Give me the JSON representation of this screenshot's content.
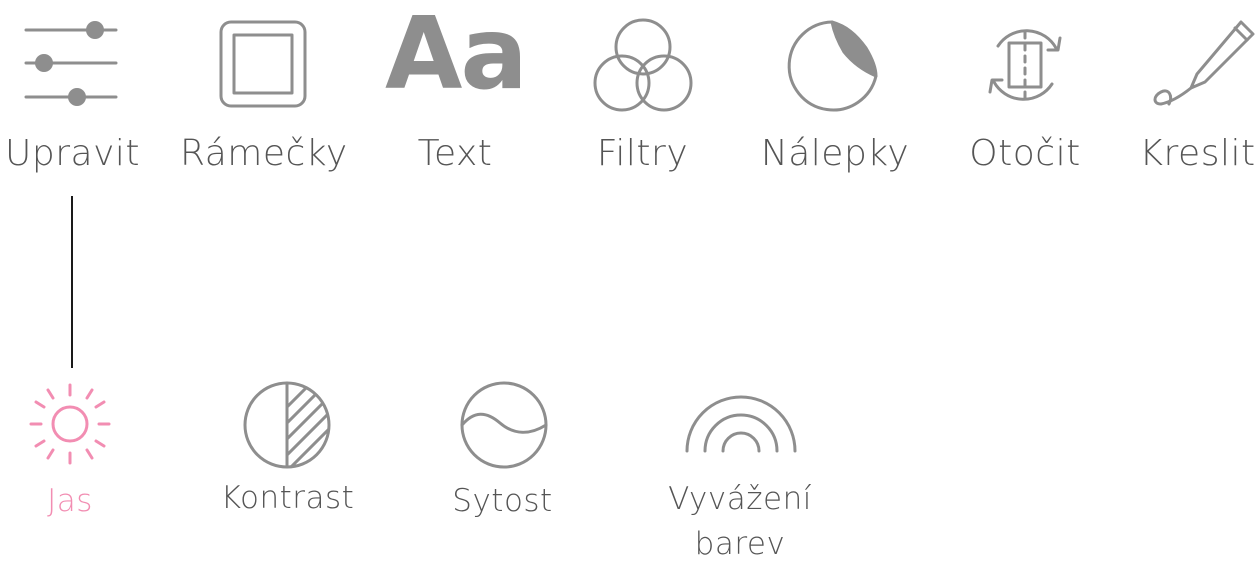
{
  "colors": {
    "icon_gray": "#8e8e8e",
    "label_gray": "#555555",
    "active_pink": "#f28db2",
    "connector": "#1a1a1a"
  },
  "toolbar": {
    "tools": [
      {
        "id": "upravit",
        "label": "Upravit",
        "icon": "sliders-icon"
      },
      {
        "id": "ramecky",
        "label": "Rámečky",
        "icon": "frame-icon"
      },
      {
        "id": "text",
        "label": "Text",
        "icon": "text-icon",
        "glyph": "Aa"
      },
      {
        "id": "filtry",
        "label": "Filtry",
        "icon": "filters-icon"
      },
      {
        "id": "nalepky",
        "label": "Nálepky",
        "icon": "sticker-icon"
      },
      {
        "id": "otocit",
        "label": "Otočit",
        "icon": "rotate-icon"
      },
      {
        "id": "kreslit",
        "label": "Kreslit",
        "icon": "pen-icon"
      }
    ]
  },
  "adjust": {
    "items": [
      {
        "id": "jas",
        "label": "Jas",
        "icon": "brightness-icon",
        "active": true
      },
      {
        "id": "kontrast",
        "label": "Kontrast",
        "icon": "contrast-icon",
        "active": false
      },
      {
        "id": "sytost",
        "label": "Sytost",
        "icon": "saturation-icon",
        "active": false
      },
      {
        "id": "vyvazeni",
        "label_line1": "Vyvážení",
        "label_line2": "barev",
        "icon": "color-balance-icon",
        "active": false
      }
    ]
  }
}
